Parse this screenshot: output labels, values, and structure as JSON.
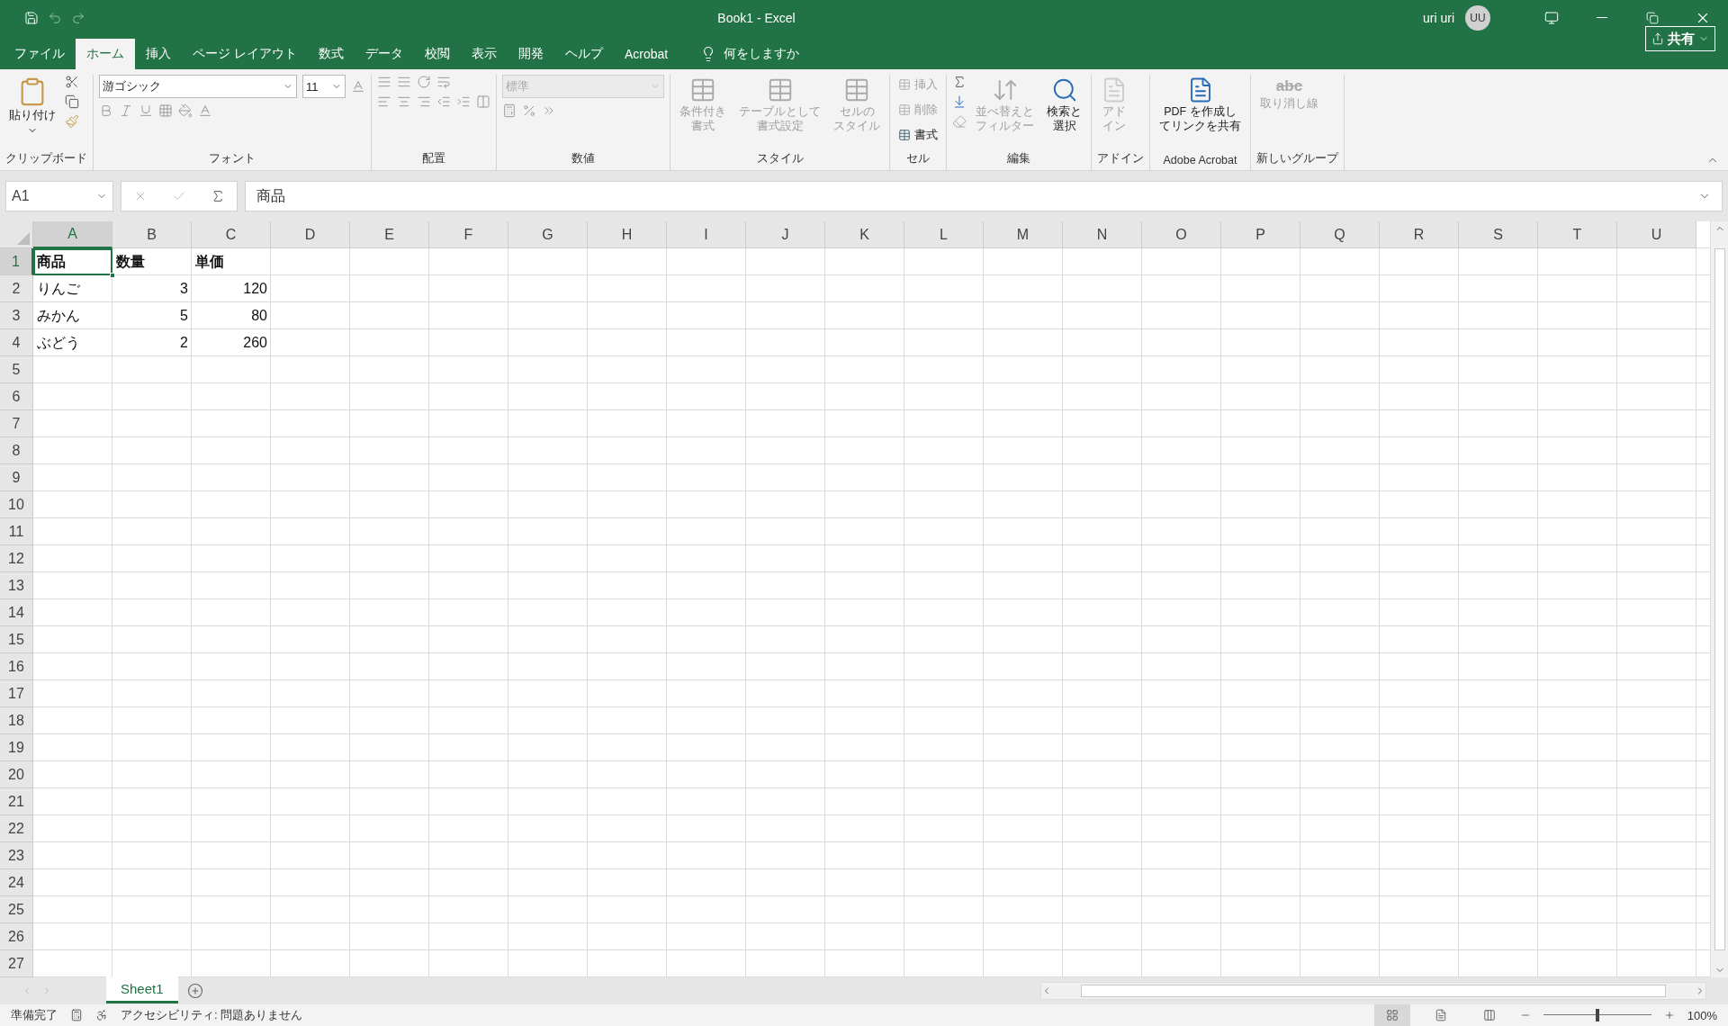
{
  "window": {
    "title": "Book1  -  Excel",
    "user": "uri uri",
    "avatar": "UU",
    "share": "共有"
  },
  "tabs": [
    {
      "label": "ファイル",
      "selected": false
    },
    {
      "label": "ホーム",
      "selected": true
    },
    {
      "label": "挿入",
      "selected": false
    },
    {
      "label": "ページ レイアウト",
      "selected": false
    },
    {
      "label": "数式",
      "selected": false
    },
    {
      "label": "データ",
      "selected": false
    },
    {
      "label": "校閲",
      "selected": false
    },
    {
      "label": "表示",
      "selected": false
    },
    {
      "label": "開発",
      "selected": false
    },
    {
      "label": "ヘルプ",
      "selected": false
    },
    {
      "label": "Acrobat",
      "selected": false
    }
  ],
  "tell_me": {
    "placeholder": "何をしますか"
  },
  "ribbon": [
    {
      "kind": "clipboard",
      "label": "クリップボード",
      "paste": "貼り付け"
    },
    {
      "kind": "font",
      "label": "フォント",
      "font_name": "游ゴシック",
      "font_size": "11"
    },
    {
      "kind": "alignment",
      "label": "配置"
    },
    {
      "kind": "number",
      "label": "数値",
      "format": "標準"
    },
    {
      "kind": "styles",
      "label": "スタイル",
      "buttons": [
        {
          "lines": [
            "条件付き",
            "書式"
          ],
          "disabled": true
        },
        {
          "lines": [
            "テーブルとして",
            "書式設定"
          ],
          "disabled": true
        },
        {
          "lines": [
            "セルの",
            "スタイル"
          ],
          "disabled": true
        }
      ]
    },
    {
      "kind": "cells",
      "label": "セル",
      "buttons": [
        {
          "text": "挿入",
          "disabled": true
        },
        {
          "text": "削除",
          "disabled": true
        },
        {
          "text": "書式",
          "disabled": false
        }
      ]
    },
    {
      "kind": "editing",
      "label": "編集",
      "buttons": [
        {
          "lines": [
            "並べ替えと",
            "フィルター"
          ],
          "disabled": true
        },
        {
          "lines": [
            "検索と",
            "選択"
          ],
          "disabled": false
        }
      ]
    },
    {
      "kind": "addins",
      "label": "アドイン",
      "buttons": [
        {
          "lines": [
            "アド",
            "イン"
          ],
          "disabled": true
        }
      ]
    },
    {
      "kind": "acrobat",
      "label": "Adobe Acrobat",
      "buttons": [
        {
          "lines": [
            "PDF を作成し",
            "てリンクを共有"
          ],
          "disabled": false
        }
      ]
    },
    {
      "kind": "custom",
      "label": "新しいグループ",
      "glyph": "abc",
      "buttons": [
        {
          "lines": [
            "取り消し線"
          ],
          "disabled": true
        }
      ]
    }
  ],
  "formula_bar": {
    "name_box": "A1",
    "formula": "商品"
  },
  "grid": {
    "columns": [
      {
        "label": "A",
        "selected": true
      },
      {
        "label": "B",
        "selected": false
      },
      {
        "label": "C",
        "selected": false
      },
      {
        "label": "D",
        "selected": false
      },
      {
        "label": "E",
        "selected": false
      },
      {
        "label": "F",
        "selected": false
      },
      {
        "label": "G",
        "selected": false
      },
      {
        "label": "H",
        "selected": false
      },
      {
        "label": "I",
        "selected": false
      },
      {
        "label": "J",
        "selected": false
      },
      {
        "label": "K",
        "selected": false
      },
      {
        "label": "L",
        "selected": false
      },
      {
        "label": "M",
        "selected": false
      },
      {
        "label": "N",
        "selected": false
      },
      {
        "label": "O",
        "selected": false
      },
      {
        "label": "P",
        "selected": false
      },
      {
        "label": "Q",
        "selected": false
      },
      {
        "label": "R",
        "selected": false
      },
      {
        "label": "S",
        "selected": false
      },
      {
        "label": "T",
        "selected": false
      },
      {
        "label": "U",
        "selected": false
      }
    ],
    "rows": [
      {
        "header": "1",
        "selected": true,
        "cells": [
          {
            "value": "商品",
            "kind": "text",
            "bold": true,
            "selected": true
          },
          {
            "value": "数量",
            "kind": "text",
            "bold": true,
            "selected": false
          },
          {
            "value": "単価",
            "kind": "text",
            "bold": true,
            "selected": false
          }
        ]
      },
      {
        "header": "2",
        "selected": false,
        "cells": [
          {
            "value": "りんご",
            "kind": "text",
            "bold": false,
            "selected": false
          },
          {
            "value": "3",
            "kind": "number",
            "bold": false,
            "selected": false
          },
          {
            "value": "120",
            "kind": "number",
            "bold": false,
            "selected": false
          }
        ]
      },
      {
        "header": "3",
        "selected": false,
        "cells": [
          {
            "value": "みかん",
            "kind": "text",
            "bold": false,
            "selected": false
          },
          {
            "value": "5",
            "kind": "number",
            "bold": false,
            "selected": false
          },
          {
            "value": "80",
            "kind": "number",
            "bold": false,
            "selected": false
          }
        ]
      },
      {
        "header": "4",
        "selected": false,
        "cells": [
          {
            "value": "ぶどう",
            "kind": "text",
            "bold": false,
            "selected": false
          },
          {
            "value": "2",
            "kind": "number",
            "bold": false,
            "selected": false
          },
          {
            "value": "260",
            "kind": "number",
            "bold": false,
            "selected": false
          }
        ]
      },
      {
        "header": "5",
        "selected": false
      },
      {
        "header": "6",
        "selected": false
      },
      {
        "header": "7",
        "selected": false
      },
      {
        "header": "8",
        "selected": false
      },
      {
        "header": "9",
        "selected": false
      },
      {
        "header": "10",
        "selected": false
      },
      {
        "header": "11",
        "selected": false
      },
      {
        "header": "12",
        "selected": false
      },
      {
        "header": "13",
        "selected": false
      },
      {
        "header": "14",
        "selected": false
      },
      {
        "header": "15",
        "selected": false
      },
      {
        "header": "16",
        "selected": false
      },
      {
        "header": "17",
        "selected": false
      },
      {
        "header": "18",
        "selected": false
      },
      {
        "header": "19",
        "selected": false
      },
      {
        "header": "20",
        "selected": false
      },
      {
        "header": "21",
        "selected": false
      },
      {
        "header": "22",
        "selected": false
      },
      {
        "header": "23",
        "selected": false
      },
      {
        "header": "24",
        "selected": false
      },
      {
        "header": "25",
        "selected": false
      },
      {
        "header": "26",
        "selected": false
      },
      {
        "header": "27",
        "selected": false
      }
    ]
  },
  "sheet_tabs": [
    {
      "label": "Sheet1",
      "selected": true
    }
  ],
  "status_bar": {
    "status": "準備完了",
    "accessibility": "アクセシビリティ: 問題ありません",
    "views": [
      {
        "kind": "normal",
        "selected": true
      },
      {
        "kind": "page_layout",
        "selected": false
      },
      {
        "kind": "page_break",
        "selected": false
      }
    ],
    "zoom": {
      "level": 0.5,
      "text": "100%"
    }
  }
}
